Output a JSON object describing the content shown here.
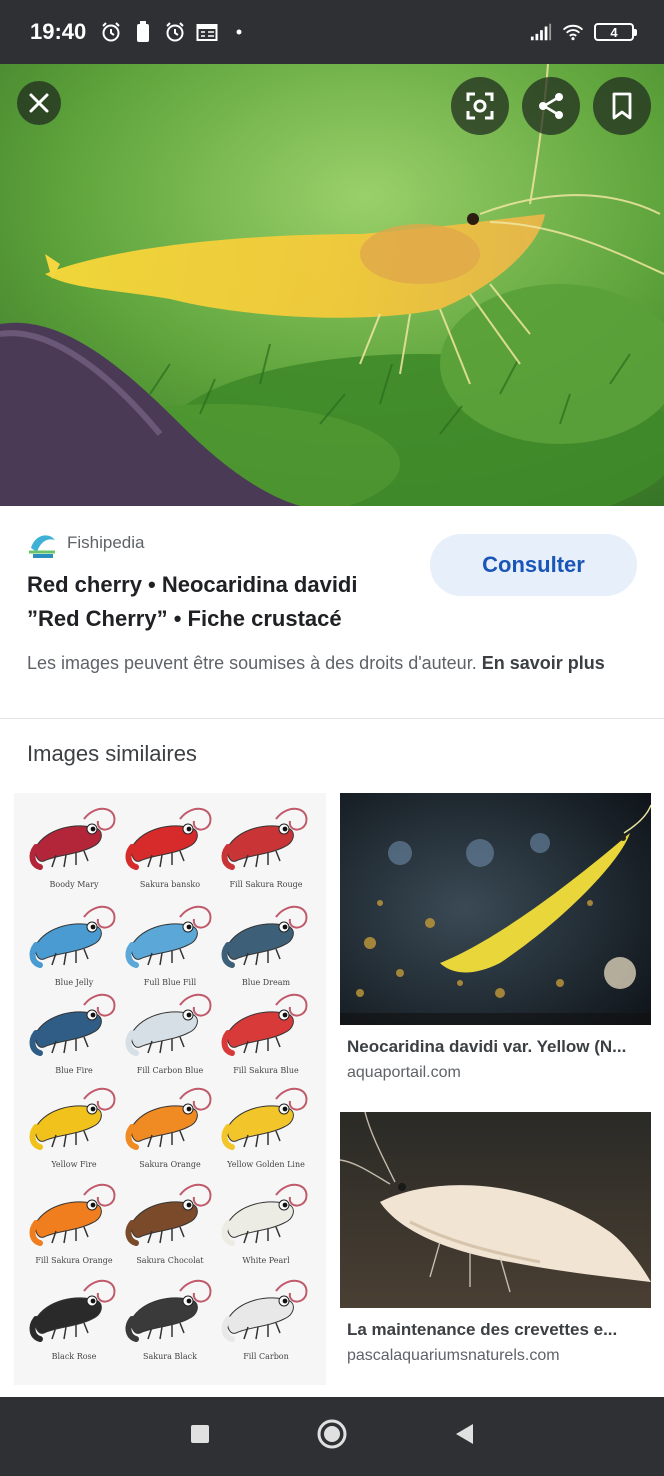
{
  "status_bar": {
    "time": "19:40",
    "battery": "4"
  },
  "result": {
    "source_name": "Fishipedia",
    "title": "Red cherry • Neocaridina davidi ”Red Cherry” • Fiche crustacé",
    "visit_label": "Consulter",
    "copyright_text": "Les images peuvent être soumises à des droits d'auteur.",
    "learn_more": "En savoir plus"
  },
  "similar": {
    "heading": "Images similaires",
    "chart_labels": [
      [
        "Boody Mary",
        "Sakura bansko",
        "Fill Sakura Rouge"
      ],
      [
        "Blue Jelly",
        "Full Blue Fill",
        "Blue Dream"
      ],
      [
        "Blue Fire",
        "Fill Carbon Blue",
        "Fill Sakura Blue"
      ],
      [
        "Yellow Fire",
        "Sakura Orange",
        "Yellow Golden Line"
      ],
      [
        "Fill Sakura Orange",
        "Sakura Chocolat",
        "White Pearl"
      ],
      [
        "Black Rose",
        "Sakura Black",
        "Fill Carbon"
      ]
    ],
    "shrimp_colors": [
      [
        "#b3263a",
        "#d72a2a",
        "#c93536"
      ],
      [
        "#4a9bd1",
        "#5aa7d8",
        "#3e5f78"
      ],
      [
        "#2f5d86",
        "#d6dfe6",
        "#d83a3a"
      ],
      [
        "#f0c21b",
        "#f08a22",
        "#f2c52a"
      ],
      [
        "#f07e1e",
        "#7a4a2a",
        "#ecebe4"
      ],
      [
        "#2a2a2a",
        "#3a3a3a",
        "#e8e8e8"
      ]
    ],
    "items": [
      {
        "caption": "Neocaridina davidi var. Yellow (N...",
        "domain": "aquaportail.com"
      },
      {
        "caption": "La maintenance des crevettes e...",
        "domain": "pascalaquariumsnaturels.com"
      }
    ]
  }
}
